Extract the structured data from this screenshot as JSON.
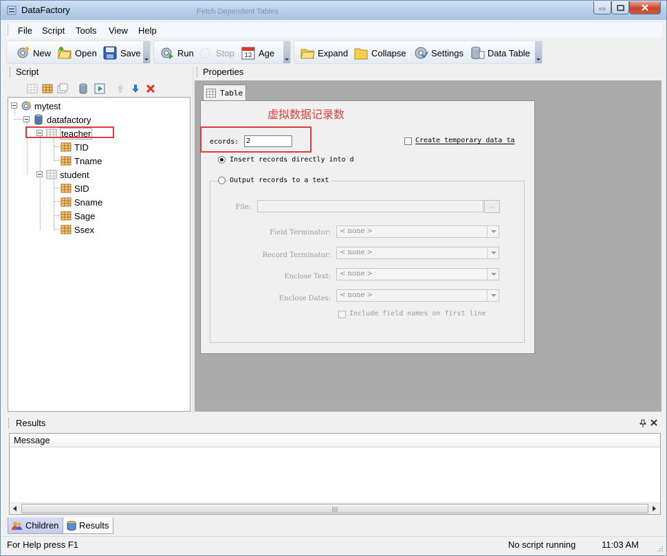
{
  "window": {
    "title": "DataFactory",
    "background_title": "Fetch Dependent Tables"
  },
  "menu": [
    "File",
    "Script",
    "Tools",
    "View",
    "Help"
  ],
  "toolbar": {
    "new": "New",
    "open": "Open",
    "save": "Save",
    "run": "Run",
    "stop": "Stop",
    "age": "Age",
    "expand": "Expand",
    "collapse": "Collapse",
    "settings": "Settings",
    "data_table": "Data Table"
  },
  "script_panel": {
    "title": "Script",
    "tree": {
      "root": "mytest",
      "database": "datafactory",
      "tables": [
        {
          "name": "teacher",
          "fields": [
            "TID",
            "Tname"
          ]
        },
        {
          "name": "student",
          "fields": [
            "SID",
            "Sname",
            "Sage",
            "Ssex"
          ]
        }
      ]
    }
  },
  "properties_panel": {
    "title": "Properties",
    "tab": "Table",
    "annotation": "虚拟数据记录数",
    "records_label": "ecords:",
    "records_value": "2",
    "create_temp_label": "Create temporary data ta",
    "insert_radio": "Insert records directly into d",
    "output_radio": "Output records to a text",
    "file_label": "File:",
    "browse_button": "...",
    "field_terminator_label": "Field Terminator:",
    "field_terminator_value": "< none >",
    "record_terminator_label": "Record Terminator:",
    "record_terminator_value": "< none >",
    "enclose_text_label": "Enclose Text:",
    "enclose_text_value": "< none >",
    "enclose_dates_label": "Enclose Dates:",
    "enclose_dates_value": "< none >",
    "include_field_names": "Include field names on first line"
  },
  "results_panel": {
    "title": "Results",
    "column": "Message"
  },
  "bottom_tabs": [
    "Children",
    "Results"
  ],
  "status": {
    "help": "For Help press F1",
    "script": "No script running",
    "time": "11:03 AM"
  },
  "colors": {
    "annotation_red": "#e23a3a",
    "title_bar": "#b6cfea"
  }
}
